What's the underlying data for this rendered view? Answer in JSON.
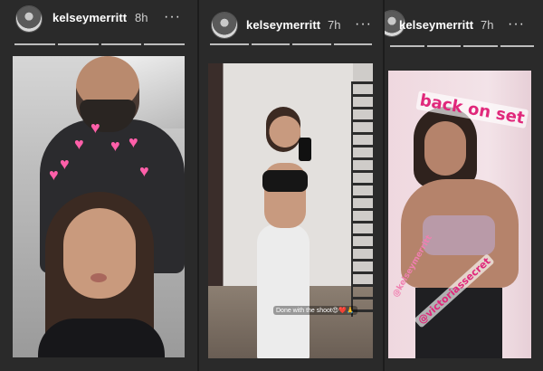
{
  "panels": [
    {
      "username": "kelseymerritt",
      "time": "8h",
      "more_icon": "more-options-icon",
      "progress_segments": 4,
      "caption": ""
    },
    {
      "username": "kelseymerritt",
      "time": "7h",
      "more_icon": "more-options-icon",
      "progress_segments": 4,
      "caption": "Done with the shoot😍❤️🙏"
    },
    {
      "username": "kelseymerritt",
      "time": "7h",
      "more_icon": "more-options-icon",
      "progress_segments": 4,
      "sticker_text": "back on set",
      "tag_text": "@victoriassecret",
      "faint_tag_text": "@kelseymerritt"
    }
  ],
  "colors": {
    "background": "#262626",
    "progress": "#bdbdbd",
    "sticker_pink": "#e0287b",
    "heart_pink": "#ff5fa9"
  },
  "more_glyph": "···"
}
